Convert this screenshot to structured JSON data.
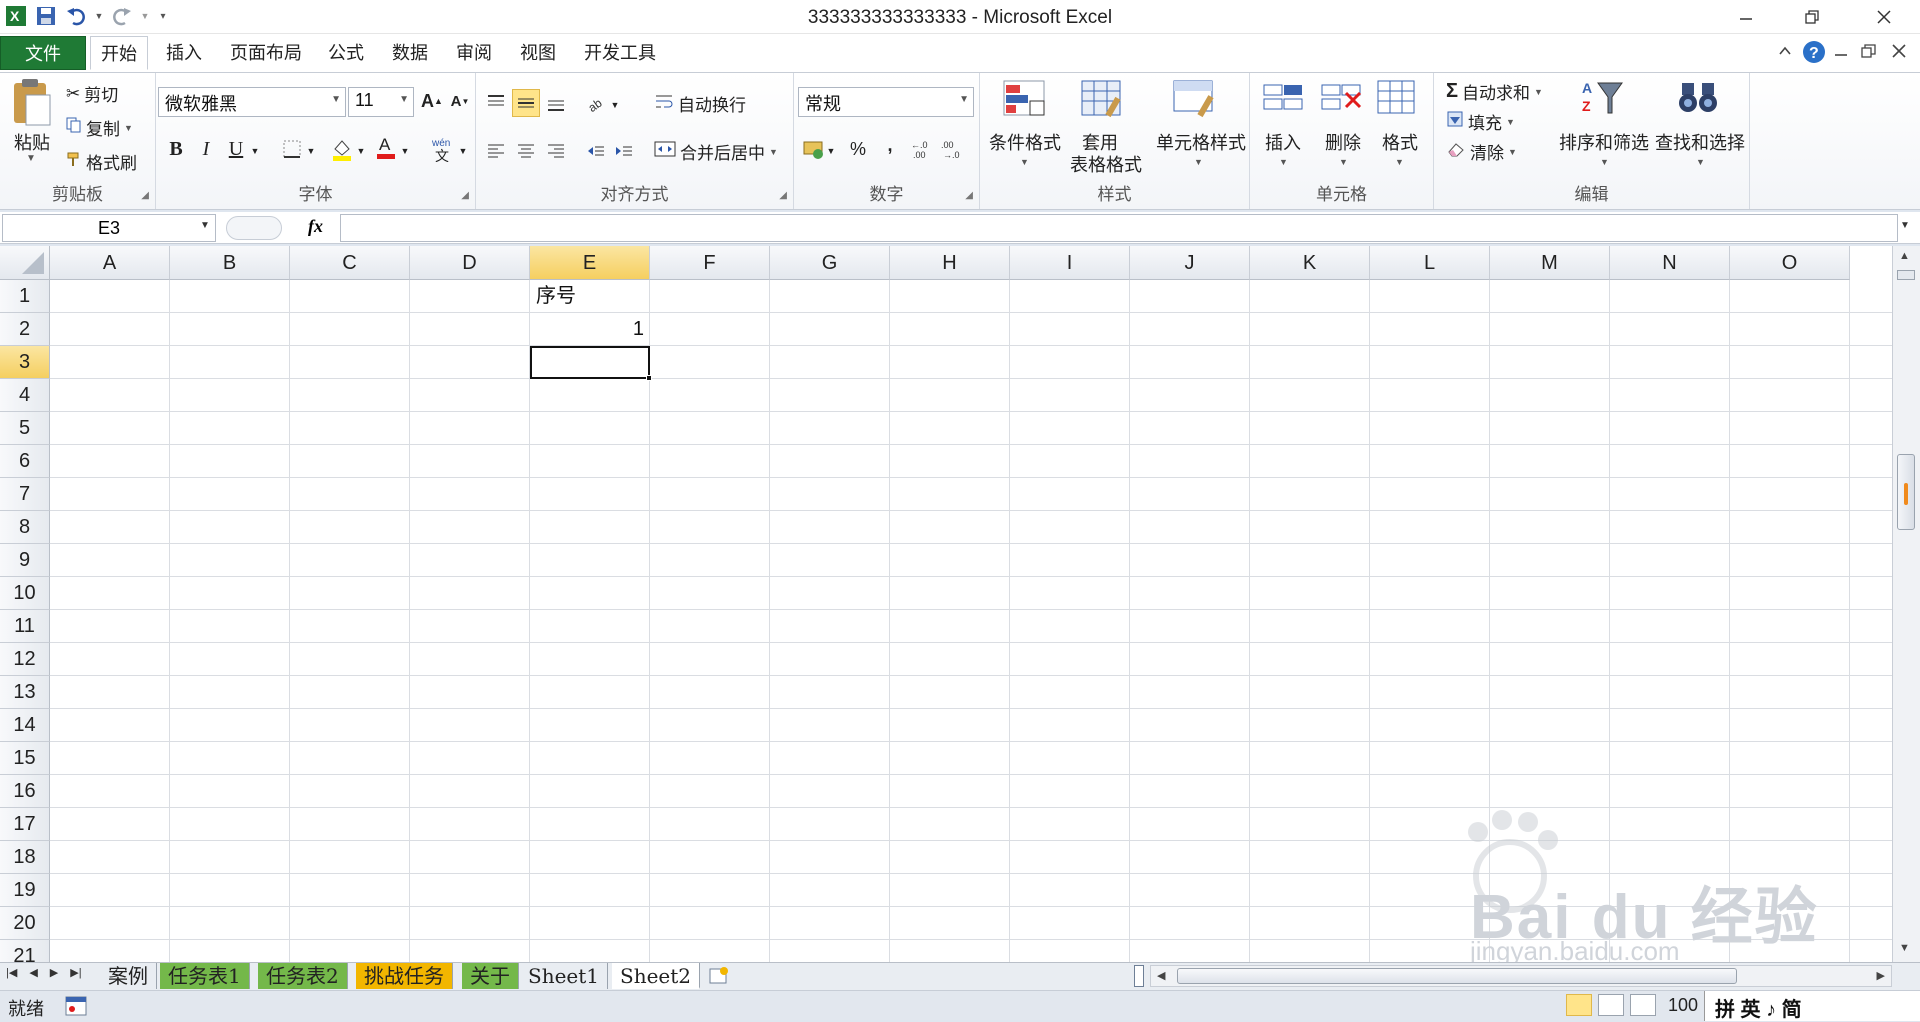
{
  "window": {
    "title": "333333333333333  -  Microsoft Excel"
  },
  "tabs": [
    {
      "label": "文件"
    },
    {
      "label": "开始"
    },
    {
      "label": "插入"
    },
    {
      "label": "页面布局"
    },
    {
      "label": "公式"
    },
    {
      "label": "数据"
    },
    {
      "label": "审阅"
    },
    {
      "label": "视图"
    },
    {
      "label": "开发工具"
    }
  ],
  "ribbon": {
    "clipboard": {
      "label": "剪贴板",
      "paste": "粘贴",
      "cut": "剪切",
      "copy": "复制",
      "format_painter": "格式刷"
    },
    "font": {
      "label": "字体",
      "font_name": "微软雅黑",
      "font_size": "11",
      "bold": "B",
      "italic": "I",
      "underline": "U"
    },
    "alignment": {
      "label": "对齐方式",
      "wrap": "自动换行",
      "merge": "合并后居中"
    },
    "number": {
      "label": "数字",
      "format": "常规",
      "percent": "%",
      "comma": ","
    },
    "styles": {
      "label": "样式",
      "conditional": "条件格式",
      "table_1": "套用",
      "table_2": "表格格式",
      "cell_styles": "单元格样式"
    },
    "cells": {
      "label": "单元格",
      "insert": "插入",
      "delete": "删除",
      "format": "格式"
    },
    "editing": {
      "label": "编辑",
      "autosum": "自动求和",
      "fill": "填充",
      "clear": "清除",
      "sort": "排序和筛选",
      "find": "查找和选择"
    }
  },
  "formula_bar": {
    "name_box": "E3",
    "fx": "fx",
    "content": ""
  },
  "grid": {
    "columns": [
      "A",
      "B",
      "C",
      "D",
      "E",
      "F",
      "G",
      "H",
      "I",
      "J",
      "K",
      "L",
      "M",
      "N",
      "O"
    ],
    "rows": [
      "1",
      "2",
      "3",
      "4",
      "5",
      "6",
      "7",
      "8",
      "9",
      "10",
      "11",
      "12",
      "13",
      "14",
      "15",
      "16",
      "17",
      "18",
      "19",
      "20",
      "21"
    ],
    "selected_cell": "E3",
    "cells": {
      "E1": "序号",
      "E2": "1"
    }
  },
  "sheets": [
    {
      "label": "案例"
    },
    {
      "label": "任务表1"
    },
    {
      "label": "任务表2"
    },
    {
      "label": "挑战任务"
    },
    {
      "label": "关于"
    },
    {
      "label": "Sheet1"
    },
    {
      "label": "Sheet2"
    }
  ],
  "status": {
    "ready": "就绪",
    "zoom": "100"
  },
  "ime": {
    "text": "拼 英 ♪ 简"
  },
  "watermark": {
    "text": "Bai du 经验",
    "sub": "jingyan.baidu.com"
  },
  "colors": {
    "file_tab": "#1f7a35",
    "selected_header": "#f5cf60",
    "accent": "#ffe48a"
  }
}
